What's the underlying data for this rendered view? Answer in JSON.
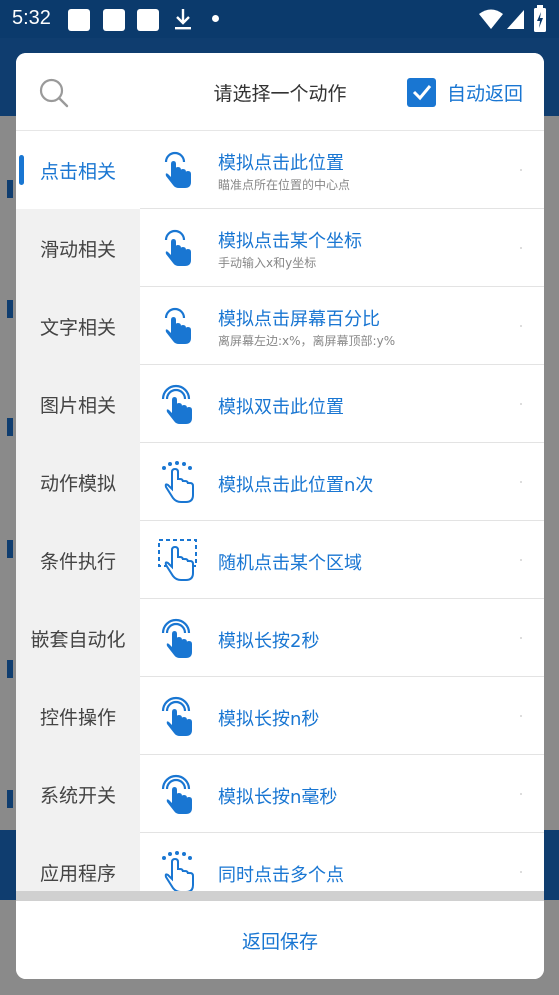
{
  "status_bar": {
    "time": "5:32"
  },
  "dialog": {
    "title": "请选择一个动作",
    "auto_return_label": "自动返回",
    "auto_return_checked": true,
    "footer_label": "返回保存"
  },
  "categories": [
    {
      "label": "点击相关",
      "active": true
    },
    {
      "label": "滑动相关"
    },
    {
      "label": "文字相关"
    },
    {
      "label": "图片相关"
    },
    {
      "label": "动作模拟"
    },
    {
      "label": "条件执行"
    },
    {
      "label": "嵌套自动化"
    },
    {
      "label": "控件操作"
    },
    {
      "label": "系统开关"
    },
    {
      "label": "应用程序"
    }
  ],
  "actions": [
    {
      "title": "模拟点击此位置",
      "subtitle": "瞄准点所在位置的中心点",
      "icon": "tap-icon"
    },
    {
      "title": "模拟点击某个坐标",
      "subtitle": "手动输入x和y坐标",
      "icon": "tap-icon"
    },
    {
      "title": "模拟点击屏幕百分比",
      "subtitle": "离屏幕左边:x%，离屏幕顶部:y%",
      "icon": "tap-icon"
    },
    {
      "title": "模拟双击此位置",
      "subtitle": "",
      "icon": "double-tap-icon"
    },
    {
      "title": "模拟点击此位置n次",
      "subtitle": "",
      "icon": "multi-tap-icon"
    },
    {
      "title": "随机点击某个区域",
      "subtitle": "",
      "icon": "area-tap-icon"
    },
    {
      "title": "模拟长按2秒",
      "subtitle": "",
      "icon": "long-press-icon"
    },
    {
      "title": "模拟长按n秒",
      "subtitle": "",
      "icon": "long-press-icon"
    },
    {
      "title": "模拟长按n毫秒",
      "subtitle": "",
      "icon": "long-press-icon"
    },
    {
      "title": "同时点击多个点",
      "subtitle": "",
      "icon": "multi-tap-icon"
    }
  ],
  "colors": {
    "accent": "#1976d2",
    "status_bar": "#0b3a6c"
  }
}
